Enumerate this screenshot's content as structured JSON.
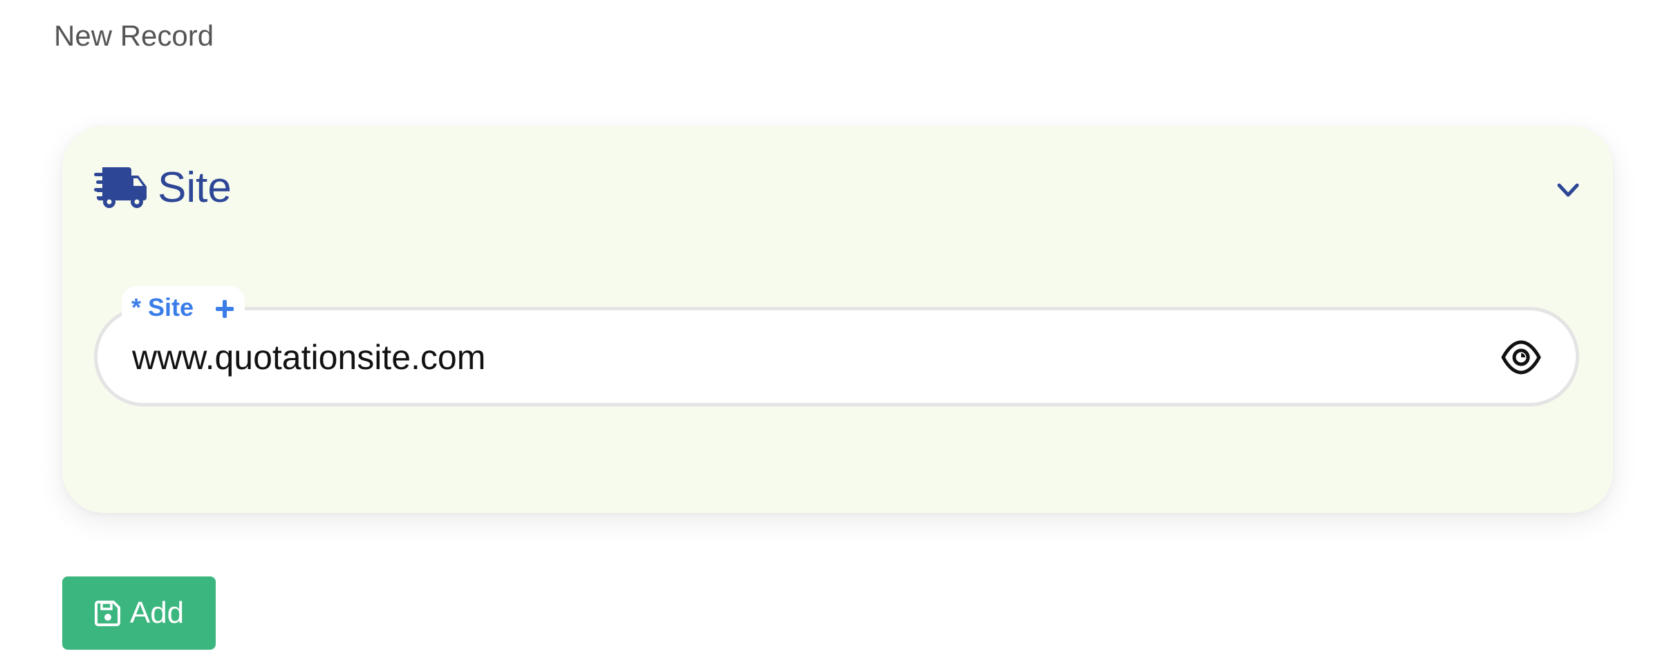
{
  "page": {
    "title": "New Record"
  },
  "section": {
    "title": "Site",
    "icon": "truck-fast-icon",
    "collapse_icon": "chevron-down-icon",
    "background_color": "#f7fbee",
    "title_color": "#2d4696"
  },
  "site_field": {
    "required_marker": "*",
    "label": "Site",
    "label_full": "* Site",
    "add_icon": "plus-icon",
    "value": "www.quotationsite.com",
    "visibility_icon": "eye-icon",
    "label_color": "#3a7de8"
  },
  "actions": {
    "add_label": "Add",
    "add_icon": "save-icon",
    "add_color": "#3bb67f"
  }
}
